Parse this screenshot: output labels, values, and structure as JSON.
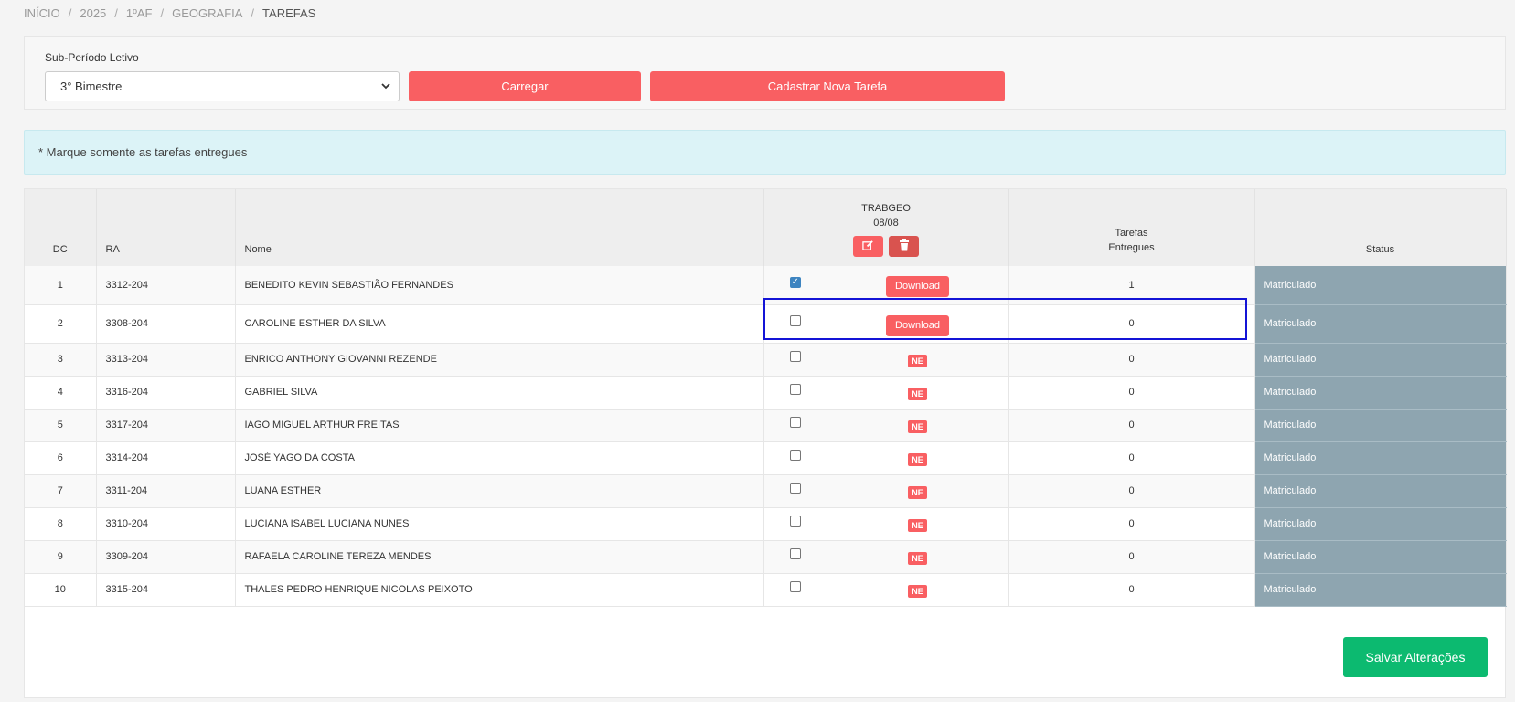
{
  "breadcrumb": [
    "INÍCIO",
    "2025",
    "1ºAF",
    "GEOGRAFIA",
    "TAREFAS"
  ],
  "filter": {
    "label": "Sub-Período Letivo",
    "selected": "3° Bimestre",
    "load_button": "Carregar",
    "new_task_button": "Cadastrar Nova Tarefa"
  },
  "alert": "* Marque somente as tarefas entregues",
  "table": {
    "headers": {
      "dc": "DC",
      "ra": "RA",
      "nome": "Nome",
      "task_name": "TRABGEO",
      "task_date": "08/08",
      "delivered_line1": "Tarefas",
      "delivered_line2": "Entregues",
      "status": "Status"
    },
    "icons": {
      "edit": "edit-icon",
      "delete": "trash-icon",
      "checkbox": "checkbox"
    },
    "download_label": "Download",
    "ne_label": "NE",
    "rows": [
      {
        "dc": "1",
        "ra": "3312-204",
        "nome": "BENEDITO KEVIN SEBASTIÃO FERNANDES",
        "checked": true,
        "file": "download",
        "entregues": "1",
        "status": "Matriculado"
      },
      {
        "dc": "2",
        "ra": "3308-204",
        "nome": "CAROLINE ESTHER DA SILVA",
        "checked": false,
        "file": "download",
        "entregues": "0",
        "status": "Matriculado"
      },
      {
        "dc": "3",
        "ra": "3313-204",
        "nome": "ENRICO ANTHONY GIOVANNI REZENDE",
        "checked": false,
        "file": "ne",
        "entregues": "0",
        "status": "Matriculado"
      },
      {
        "dc": "4",
        "ra": "3316-204",
        "nome": "GABRIEL SILVA",
        "checked": false,
        "file": "ne",
        "entregues": "0",
        "status": "Matriculado"
      },
      {
        "dc": "5",
        "ra": "3317-204",
        "nome": "IAGO MIGUEL ARTHUR FREITAS",
        "checked": false,
        "file": "ne",
        "entregues": "0",
        "status": "Matriculado"
      },
      {
        "dc": "6",
        "ra": "3314-204",
        "nome": "JOSÉ YAGO DA COSTA",
        "checked": false,
        "file": "ne",
        "entregues": "0",
        "status": "Matriculado"
      },
      {
        "dc": "7",
        "ra": "3311-204",
        "nome": "LUANA ESTHER",
        "checked": false,
        "file": "ne",
        "entregues": "0",
        "status": "Matriculado"
      },
      {
        "dc": "8",
        "ra": "3310-204",
        "nome": "LUCIANA ISABEL LUCIANA NUNES",
        "checked": false,
        "file": "ne",
        "entregues": "0",
        "status": "Matriculado"
      },
      {
        "dc": "9",
        "ra": "3309-204",
        "nome": "RAFAELA CAROLINE TEREZA MENDES",
        "checked": false,
        "file": "ne",
        "entregues": "0",
        "status": "Matriculado"
      },
      {
        "dc": "10",
        "ra": "3315-204",
        "nome": "THALES PEDRO HENRIQUE NICOLAS PEIXOTO",
        "checked": false,
        "file": "ne",
        "entregues": "0",
        "status": "Matriculado"
      }
    ]
  },
  "save_button": "Salvar Alterações",
  "colors": {
    "primary_red": "#f95f62",
    "save_green": "#0cba70",
    "status_bg": "#8ea5b0",
    "highlight": "#1414d6"
  }
}
